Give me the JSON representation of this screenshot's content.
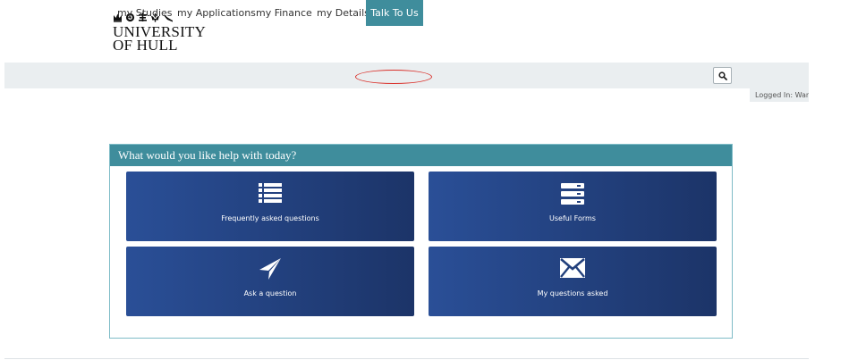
{
  "brand": {
    "line1": "UNIVERSITY",
    "line2": "OF HULL"
  },
  "nav": {
    "items": [
      {
        "label": "my Studies",
        "active": false
      },
      {
        "label": "my Applications",
        "active": false
      },
      {
        "label": "my Finance",
        "active": false
      },
      {
        "label": "my Details",
        "active": false
      },
      {
        "label": "Talk To Us",
        "active": true
      }
    ],
    "search_icon": "search-icon",
    "logged_in": "Logged In: Wan"
  },
  "help": {
    "title": "What would you like help with today?",
    "tiles": [
      {
        "label": "Frequently asked questions",
        "icon": "list-icon"
      },
      {
        "label": "Useful Forms",
        "icon": "forms-icon"
      },
      {
        "label": "Ask a question",
        "icon": "paper-plane-icon"
      },
      {
        "label": "My questions asked",
        "icon": "envelope-icon"
      }
    ]
  },
  "colors": {
    "accent": "#3f8d9c",
    "tile_dark": "#1c3468",
    "tile_light": "#2a4f97",
    "annotation": "#d9302a"
  }
}
